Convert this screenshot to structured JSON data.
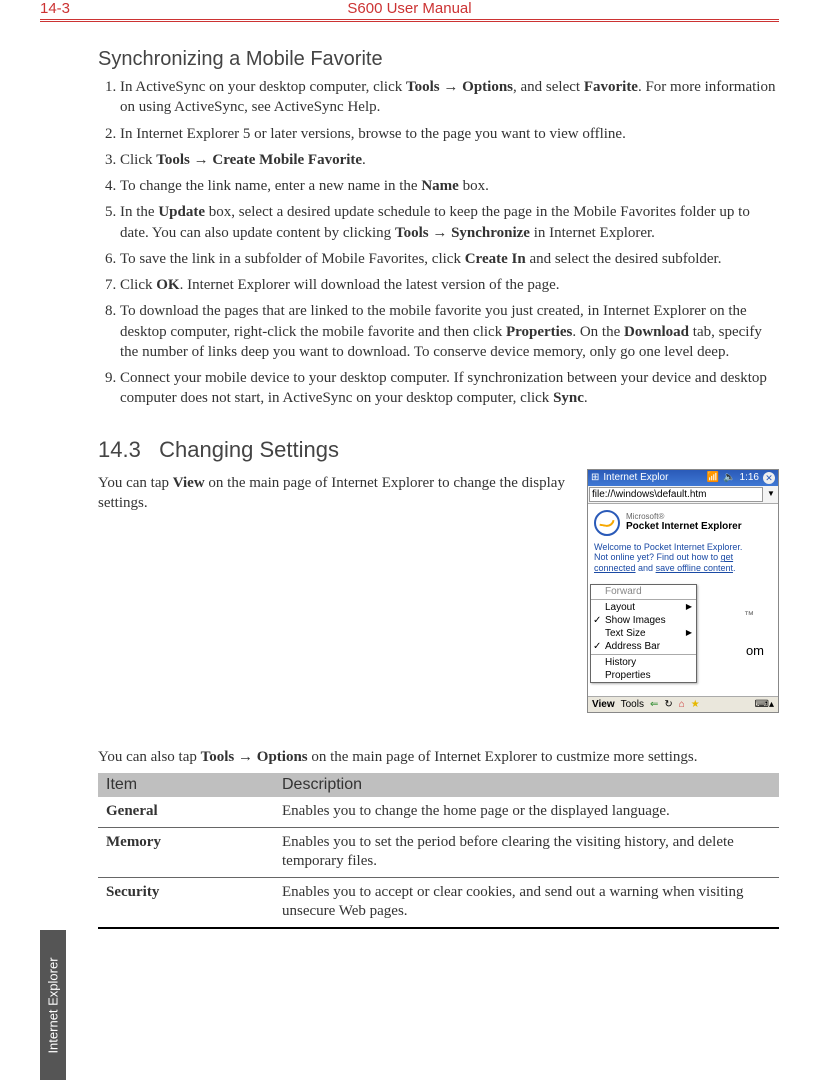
{
  "header": {
    "page_num": "14-3",
    "manual_title": "S600 User Manual"
  },
  "side_tab": "Internet Explorer",
  "section1": {
    "title": "Synchronizing a Mobile Favorite",
    "steps": [
      "In ActiveSync on your desktop computer, click <b>Tools → Options</b>, and select <b>Favorite</b>. For more information on using ActiveSync, see ActiveSync Help.",
      "In Internet Explorer 5 or later versions, browse to the page you want to view offline.",
      "Click <b>Tools → Create Mobile Favorite</b>.",
      "To change the link name, enter a new name in the <b>Name</b> box.",
      "In the <b>Update</b> box, select a desired update schedule to keep the page in the Mobile Favorites folder up to date. You can also update content by clicking <b>Tools → Synchronize</b> in Internet Explorer.",
      "To save the link in a subfolder of Mobile Favorites, click <b>Create In</b> and select the desired subfolder.",
      "Click <b>OK</b>. Internet Explorer will download the latest version of the page.",
      "To download the pages that are linked to the mobile favorite you just created, in Internet Explorer on the desktop computer, right-click the mobile favorite and then click <b>Properties</b>. On the <b>Download</b> tab, specify the number of links deep you want to download. To conserve device memory, only go one level deep.",
      "Connect your mobile device to your desktop computer. If synchronization between your device and desktop computer does not start, in ActiveSync on your desktop computer, click <b>Sync</b>."
    ]
  },
  "section2": {
    "heading_num": "14.3",
    "heading_text": "Changing Settings",
    "intro": "You can tap <b>View</b> on the main page of Internet Explorer to change the display settings.",
    "para_after_shot": "You can also tap <b>Tools → Options</b> on the main page of Internet Explorer to custmize more settings."
  },
  "device": {
    "titlebar": "Internet Explor",
    "signal": "📶",
    "speaker": "🔈",
    "time": "1:16",
    "address": "file://\\windows\\default.htm",
    "ms": "Microsoft®",
    "pie": "Pocket Internet Explorer",
    "welcome_1": "Welcome to Pocket Internet Explorer.",
    "welcome_2": "Not online yet? Find out how to ",
    "welcome_link1": "get connected",
    "welcome_mid": " and ",
    "welcome_link2": "save offline content",
    "welcome_end": ".",
    "menu": {
      "forward": "Forward",
      "layout": "Layout",
      "show_images": "Show Images",
      "text_size": "Text Size",
      "address_bar": "Address Bar",
      "history": "History",
      "properties": "Properties"
    },
    "behind_om": "om",
    "behind_tm": "™",
    "footer": {
      "view": "View",
      "tools": "Tools"
    }
  },
  "table": {
    "h_item": "Item",
    "h_desc": "Description",
    "rows": [
      {
        "item": "General",
        "desc": "Enables you to change the home page or the displayed language."
      },
      {
        "item": "Memory",
        "desc": "Enables you to set the period before clearing the visiting history, and delete temporary files."
      },
      {
        "item": "Security",
        "desc": "Enables you to accept or clear cookies, and send out a warning when visiting unsecure Web pages."
      }
    ]
  }
}
